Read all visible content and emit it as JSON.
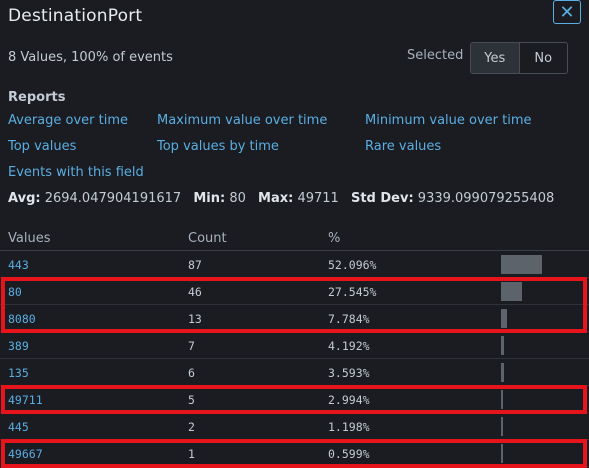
{
  "title": "DestinationPort",
  "close_glyph": "✕",
  "summary": "8 Values, 100% of events",
  "selected_label": "Selected",
  "toggle": {
    "yes": "Yes",
    "no": "No"
  },
  "reports": {
    "heading": "Reports",
    "links": [
      "Average over time",
      "Maximum value over time",
      "Minimum value over time",
      "Top values",
      "Top values by time",
      "Rare values",
      "Events with this field"
    ]
  },
  "stats": {
    "avg_label": "Avg:",
    "avg": "2694.047904191617",
    "min_label": "Min:",
    "min": "80",
    "max_label": "Max:",
    "max": "49711",
    "std_label": "Std Dev:",
    "std": "9339.099079255408"
  },
  "table": {
    "headers": [
      "Values",
      "Count",
      "%"
    ],
    "rows": [
      {
        "value": "443",
        "count": "87",
        "pct": "52.096%",
        "fraction": 0.52096,
        "highlighted": false
      },
      {
        "value": "80",
        "count": "46",
        "pct": "27.545%",
        "fraction": 0.27545,
        "highlighted": true
      },
      {
        "value": "8080",
        "count": "13",
        "pct": "7.784%",
        "fraction": 0.07784,
        "highlighted": true
      },
      {
        "value": "389",
        "count": "7",
        "pct": "4.192%",
        "fraction": 0.04192,
        "highlighted": false
      },
      {
        "value": "135",
        "count": "6",
        "pct": "3.593%",
        "fraction": 0.03593,
        "highlighted": false
      },
      {
        "value": "49711",
        "count": "5",
        "pct": "2.994%",
        "fraction": 0.02994,
        "highlighted": true
      },
      {
        "value": "445",
        "count": "2",
        "pct": "1.198%",
        "fraction": 0.01198,
        "highlighted": false
      },
      {
        "value": "49667",
        "count": "1",
        "pct": "0.599%",
        "fraction": 0.00599,
        "highlighted": true
      }
    ]
  },
  "colors": {
    "accent": "#5aaee2",
    "highlight": "#e8141c",
    "bar": "#5c636b"
  }
}
